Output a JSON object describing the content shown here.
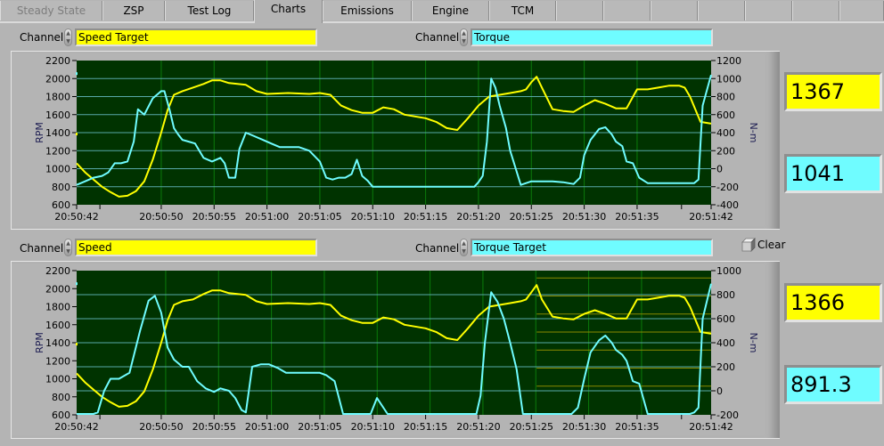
{
  "tabs": [
    {
      "label": "Steady State",
      "state": "disabled"
    },
    {
      "label": "ZSP",
      "state": "normal"
    },
    {
      "label": "Test Log",
      "state": "normal"
    },
    {
      "label": "Charts",
      "state": "active"
    },
    {
      "label": "Emissions",
      "state": "normal"
    },
    {
      "label": "Engine",
      "state": "normal"
    },
    {
      "label": "TCM",
      "state": "normal"
    },
    {
      "label": "",
      "state": "normal"
    },
    {
      "label": "",
      "state": "normal"
    },
    {
      "label": "",
      "state": "normal"
    },
    {
      "label": "",
      "state": "normal"
    }
  ],
  "colors": {
    "series1": "#ffff00",
    "series2": "#6ffcff",
    "plot_bg": "#003300",
    "grid_vertical": "#0a7a0a",
    "grid_horizontal": "#58a8a8",
    "grid_extra": "#8a8a00"
  },
  "chart1": {
    "channel1_label": "Channel",
    "channel1_value": "Speed Target",
    "channel2_label": "Channel",
    "channel2_value": "Torque",
    "readout1": "1367",
    "readout2": "1041"
  },
  "chart2": {
    "channel1_label": "Channel",
    "channel1_value": "Speed",
    "channel2_label": "Channel",
    "channel2_value": "Torque Target",
    "readout1": "1366",
    "readout2": "891.3",
    "clear_label": "Clear"
  },
  "chart_data": [
    {
      "type": "line",
      "title": "",
      "xlabel": "",
      "ylabel": "RPM",
      "y2label": "N-m",
      "xlim_seconds": [
        0,
        60
      ],
      "x_start_time": "20:50:42",
      "ylim": [
        600,
        2200
      ],
      "y2lim": [
        -400,
        1200
      ],
      "yticks": [
        600,
        800,
        1000,
        1200,
        1400,
        1600,
        1800,
        2000,
        2200
      ],
      "y2ticks": [
        -400,
        -200,
        0,
        200,
        400,
        600,
        800,
        1000,
        1200
      ],
      "xtick_seconds": [
        0,
        8,
        13,
        18,
        23,
        28,
        33,
        38,
        43,
        48,
        53,
        60
      ],
      "xtick_labels": [
        "20:50:42",
        "20:50:50",
        "20:50:55",
        "20:51:00",
        "20:51:05",
        "20:51:10",
        "20:51:15",
        "20:51:20",
        "20:51:25",
        "20:51:30",
        "20:51:35",
        "20:51:42"
      ],
      "minor_tick_seconds": [
        2.2,
        57.2
      ],
      "grid": true,
      "series": [
        {
          "name": "Speed Target",
          "axis": "left",
          "color": "#ffff00",
          "x": [
            0,
            0.8,
            1.6,
            2.4,
            3.2,
            4.0,
            4.8,
            5.6,
            6.4,
            7.2,
            8.0,
            8.6,
            9.2,
            10,
            11,
            12,
            12.8,
            13.6,
            14.4,
            15.2,
            16,
            17,
            18,
            20,
            22,
            23,
            24,
            25,
            26,
            27,
            28,
            29,
            30,
            31,
            32,
            33,
            34,
            35,
            36,
            37,
            38,
            39,
            40,
            41,
            42,
            42.5,
            43,
            43.5,
            44,
            45,
            46,
            47,
            48,
            49,
            50,
            51,
            52,
            53,
            54,
            55,
            56,
            57,
            57.5,
            58,
            59,
            60
          ],
          "y": [
            1060,
            960,
            880,
            800,
            740,
            690,
            700,
            750,
            860,
            1100,
            1400,
            1650,
            1820,
            1860,
            1900,
            1940,
            1980,
            1980,
            1950,
            1940,
            1930,
            1860,
            1830,
            1840,
            1830,
            1840,
            1820,
            1700,
            1650,
            1620,
            1620,
            1680,
            1660,
            1600,
            1580,
            1560,
            1520,
            1450,
            1430,
            1560,
            1700,
            1800,
            1820,
            1840,
            1860,
            1880,
            1960,
            2020,
            1900,
            1660,
            1640,
            1630,
            1700,
            1760,
            1720,
            1670,
            1670,
            1880,
            1880,
            1900,
            1920,
            1920,
            1900,
            1800,
            1520,
            1500,
            1380,
            1367
          ]
        },
        {
          "name": "Torque",
          "axis": "right",
          "color": "#6ffcff",
          "x": [
            0,
            0.8,
            1.6,
            2.4,
            3.0,
            3.6,
            4.2,
            4.8,
            5.4,
            5.8,
            6.4,
            7.2,
            8.0,
            8.3,
            8.8,
            9.2,
            9.6,
            10,
            10.6,
            11.2,
            12,
            12.8,
            13.6,
            14.0,
            14.4,
            15.0,
            15.4,
            16,
            16.8,
            17.6,
            18.4,
            19.2,
            20,
            21,
            22,
            23,
            23.6,
            24.2,
            24.8,
            25.4,
            26,
            26.5,
            27,
            27.5,
            28,
            28.5,
            29,
            30,
            31,
            32,
            33,
            34,
            35,
            36,
            36.8,
            37.2,
            37.6,
            38.0,
            38.4,
            38.8,
            39.2,
            39.6,
            40,
            40.6,
            41,
            42,
            43,
            43.6,
            44,
            45,
            46,
            47,
            47.6,
            48,
            48.6,
            49.4,
            50,
            50.6,
            51,
            51.6,
            52,
            52.6,
            53.2,
            54,
            55,
            56,
            57,
            57.6,
            58.0,
            58.4,
            58.8,
            59.2,
            60
          ],
          "y": [
            -180,
            -140,
            -100,
            -80,
            -40,
            60,
            60,
            80,
            300,
            660,
            600,
            780,
            860,
            860,
            650,
            450,
            380,
            320,
            300,
            280,
            120,
            80,
            120,
            60,
            -100,
            -100,
            220,
            400,
            360,
            320,
            280,
            240,
            240,
            240,
            200,
            80,
            -100,
            -120,
            -100,
            -100,
            -60,
            100,
            -80,
            -130,
            -200,
            -200,
            -200,
            -200,
            -200,
            -200,
            -200,
            -200,
            -200,
            -200,
            -200,
            -200,
            -200,
            -150,
            -80,
            300,
            1000,
            900,
            700,
            450,
            200,
            -180,
            -140,
            -140,
            -140,
            -140,
            -150,
            -170,
            -100,
            150,
            320,
            440,
            460,
            380,
            300,
            250,
            80,
            60,
            -100,
            -160,
            -160,
            -160,
            -160,
            -160,
            -160,
            -160,
            -120,
            700,
            1041
          ]
        }
      ]
    },
    {
      "type": "line",
      "title": "",
      "xlabel": "",
      "ylabel": "RPM",
      "y2label": "N-m",
      "xlim_seconds": [
        0,
        60
      ],
      "x_start_time": "20:50:42",
      "ylim": [
        600,
        2200
      ],
      "y2lim": [
        -200,
        1000
      ],
      "yticks": [
        600,
        800,
        1000,
        1200,
        1400,
        1600,
        1800,
        2000,
        2200
      ],
      "y2ticks": [
        -200,
        0,
        200,
        400,
        600,
        800,
        1000
      ],
      "xtick_seconds": [
        0,
        8,
        13,
        18,
        23,
        28,
        33,
        38,
        43,
        48,
        53,
        60
      ],
      "xtick_labels": [
        "20:50:42",
        "20:50:50",
        "20:50:55",
        "20:51:00",
        "20:51:05",
        "20:51:10",
        "20:51:15",
        "20:51:20",
        "20:51:25",
        "20:51:30",
        "20:51:35",
        "20:51:42"
      ],
      "minor_tick_seconds": [
        2.2,
        57.2
      ],
      "grid": true,
      "series": [
        {
          "name": "Speed",
          "axis": "left",
          "color": "#ffff00",
          "x": [
            0,
            0.8,
            1.6,
            2.4,
            3.2,
            4.0,
            4.8,
            5.6,
            6.4,
            7.2,
            8.0,
            8.6,
            9.2,
            10,
            11,
            12,
            12.8,
            13.6,
            14.4,
            15.2,
            16,
            17,
            18,
            20,
            22,
            23,
            24,
            25,
            26,
            27,
            28,
            29,
            30,
            31,
            32,
            33,
            34,
            35,
            36,
            37,
            38,
            39,
            40,
            41,
            42,
            42.5,
            43,
            43.5,
            44,
            45,
            46,
            47,
            48,
            49,
            50,
            51,
            52,
            53,
            54,
            55,
            56,
            57,
            57.5,
            58,
            59,
            60
          ],
          "y": [
            1060,
            960,
            880,
            800,
            740,
            690,
            700,
            750,
            860,
            1100,
            1400,
            1650,
            1820,
            1860,
            1880,
            1940,
            1980,
            1980,
            1950,
            1940,
            1930,
            1860,
            1830,
            1840,
            1830,
            1840,
            1820,
            1700,
            1650,
            1620,
            1620,
            1680,
            1660,
            1600,
            1580,
            1560,
            1520,
            1450,
            1430,
            1560,
            1700,
            1800,
            1820,
            1840,
            1860,
            1880,
            1960,
            2040,
            1880,
            1690,
            1670,
            1660,
            1720,
            1760,
            1720,
            1670,
            1670,
            1880,
            1880,
            1900,
            1920,
            1920,
            1900,
            1800,
            1520,
            1500,
            1380,
            1366
          ]
        },
        {
          "name": "Torque Target",
          "axis": "right",
          "color": "#6ffcff",
          "x": [
            0,
            1.0,
            1.6,
            2.0,
            2.6,
            3.2,
            4.0,
            5.0,
            6.0,
            6.8,
            7.4,
            8.0,
            8.6,
            9.2,
            10,
            10.6,
            11.4,
            12.2,
            13,
            13.6,
            14.4,
            15.0,
            15.6,
            16.0,
            16.6,
            17.4,
            18.2,
            19,
            19.8,
            21,
            22,
            23,
            23.6,
            24.4,
            25.2,
            26,
            26.6,
            27.2,
            27.8,
            28.4,
            29.4,
            30.6,
            31.6,
            32.6,
            33.6,
            34.6,
            35.6,
            36.6,
            37.3,
            37.8,
            38.2,
            38.6,
            39.2,
            39.8,
            40.4,
            41,
            41.6,
            42.2,
            43,
            44,
            45,
            46,
            46.8,
            47.4,
            48,
            48.6,
            49.4,
            50,
            50.6,
            51,
            51.6,
            52,
            52.6,
            53.2,
            54,
            55,
            56,
            57,
            57.6,
            58.0,
            58.4,
            58.8,
            59.2,
            60
          ],
          "y": [
            -200,
            -200,
            -200,
            -180,
            0,
            100,
            100,
            150,
            500,
            750,
            790,
            650,
            360,
            260,
            200,
            200,
            80,
            20,
            -10,
            20,
            0,
            -60,
            -160,
            -180,
            200,
            220,
            220,
            190,
            150,
            150,
            150,
            150,
            130,
            80,
            -200,
            -200,
            -200,
            -200,
            -200,
            -60,
            -200,
            -200,
            -200,
            -200,
            -200,
            -200,
            -200,
            -200,
            -200,
            -200,
            -40,
            400,
            820,
            740,
            600,
            400,
            180,
            -200,
            -200,
            -200,
            -200,
            -200,
            -200,
            -140,
            100,
            320,
            420,
            460,
            400,
            340,
            300,
            250,
            80,
            60,
            -200,
            -200,
            -200,
            -200,
            -200,
            -200,
            -180,
            -140,
            600,
            891.3
          ]
        }
      ]
    }
  ]
}
